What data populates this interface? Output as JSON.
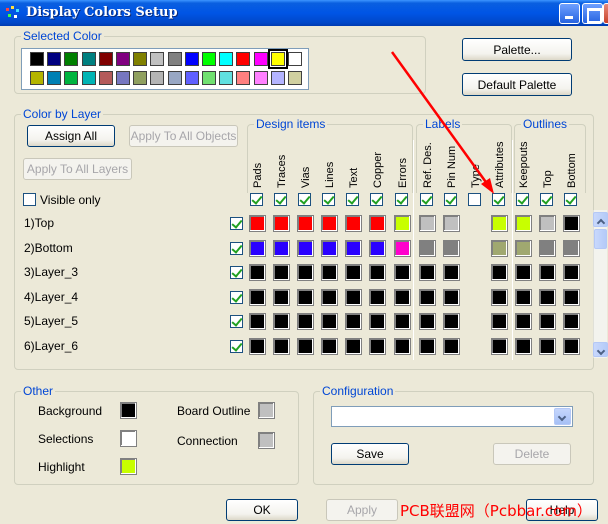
{
  "window": {
    "title": "Display Colors Setup"
  },
  "selected_color": {
    "title": "Selected Color",
    "palette_row1": [
      "#000000",
      "#000080",
      "#008000",
      "#008080",
      "#800000",
      "#800080",
      "#808000",
      "#c0c0c0",
      "#808080",
      "#0000ff",
      "#00ff00",
      "#00ffff",
      "#ff0000",
      "#ff00ff",
      "#ffff00",
      "#ffffff"
    ],
    "palette_row2": [
      "#b4b400",
      "#0080b4",
      "#00b440",
      "#00b4b4",
      "#b45a5a",
      "#7777c0",
      "#90a060",
      "#b4b4b4",
      "#98a7c4",
      "#6060ff",
      "#70e070",
      "#60e0e0",
      "#ff8080",
      "#ff80ff",
      "#b4b4ff",
      "#d0d0a0"
    ],
    "palette_button": "Palette...",
    "default_palette_button": "Default Palette"
  },
  "color_by_layer": {
    "title": "Color by Layer",
    "assign_all": "Assign All",
    "apply_to_all_objects": "Apply To All Objects",
    "apply_to_all_layers": "Apply To All Layers",
    "visible_only": "Visible only",
    "group_design_items": "Design items",
    "group_labels": "Labels",
    "group_outlines": "Outlines",
    "columns": [
      "Pads",
      "Traces",
      "Vias",
      "Lines",
      "Text",
      "Copper",
      "Errors",
      "Ref. Des.",
      "Pin Num",
      "Type",
      "Attributes",
      "Keepouts",
      "Top",
      "Bottom"
    ],
    "column_checked": [
      true,
      true,
      true,
      true,
      true,
      true,
      true,
      true,
      true,
      false,
      true,
      true,
      true,
      true
    ],
    "layers": [
      {
        "name": "1)Top",
        "visible": true,
        "colors": [
          "#ff0000",
          "#ff0000",
          "#ff0000",
          "#ff0000",
          "#ff0000",
          "#ff0000",
          "#c8ff00",
          "#c0c0c0",
          "#c0c0c0",
          null,
          "#c8ff00",
          "#c8ff00",
          "#c0c0c0",
          "#000000"
        ]
      },
      {
        "name": "2)Bottom",
        "visible": true,
        "colors": [
          "#2a00ff",
          "#2a00ff",
          "#2a00ff",
          "#2a00ff",
          "#2a00ff",
          "#2a00ff",
          "#ff00cc",
          "#808080",
          "#808080",
          null,
          "#a0a870",
          "#a0a870",
          "#808080",
          "#808080"
        ]
      },
      {
        "name": "3)Layer_3",
        "visible": true,
        "colors": [
          "#000000",
          "#000000",
          "#000000",
          "#000000",
          "#000000",
          "#000000",
          "#000000",
          "#000000",
          "#000000",
          null,
          "#000000",
          "#000000",
          "#000000",
          "#000000"
        ]
      },
      {
        "name": "4)Layer_4",
        "visible": true,
        "colors": [
          "#000000",
          "#000000",
          "#000000",
          "#000000",
          "#000000",
          "#000000",
          "#000000",
          "#000000",
          "#000000",
          null,
          "#000000",
          "#000000",
          "#000000",
          "#000000"
        ]
      },
      {
        "name": "5)Layer_5",
        "visible": true,
        "colors": [
          "#000000",
          "#000000",
          "#000000",
          "#000000",
          "#000000",
          "#000000",
          "#000000",
          "#000000",
          "#000000",
          null,
          "#000000",
          "#000000",
          "#000000",
          "#000000"
        ]
      },
      {
        "name": "6)Layer_6",
        "visible": true,
        "colors": [
          "#000000",
          "#000000",
          "#000000",
          "#000000",
          "#000000",
          "#000000",
          "#000000",
          "#000000",
          "#000000",
          null,
          "#000000",
          "#000000",
          "#000000",
          "#000000"
        ]
      }
    ]
  },
  "other": {
    "title": "Other",
    "background": "Background",
    "background_color": "#000000",
    "selections": "Selections",
    "selections_color": "#ffffff",
    "highlight": "Highlight",
    "highlight_color": "#c8ff00",
    "board_outline": "Board Outline",
    "board_outline_color": "#c0c0c0",
    "connection": "Connection",
    "connection_color": "#c0c0c0"
  },
  "configuration": {
    "title": "Configuration",
    "combo_value": "",
    "save": "Save",
    "delete": "Delete"
  },
  "footer": {
    "ok": "OK",
    "apply": "Apply",
    "help": "Help"
  },
  "watermark": "PCB联盟网（Pcbbar.com）",
  "colors": {
    "title_bar": "#0055e5",
    "group_title": "#0046d5",
    "annotation_arrow": "#ff0000"
  }
}
